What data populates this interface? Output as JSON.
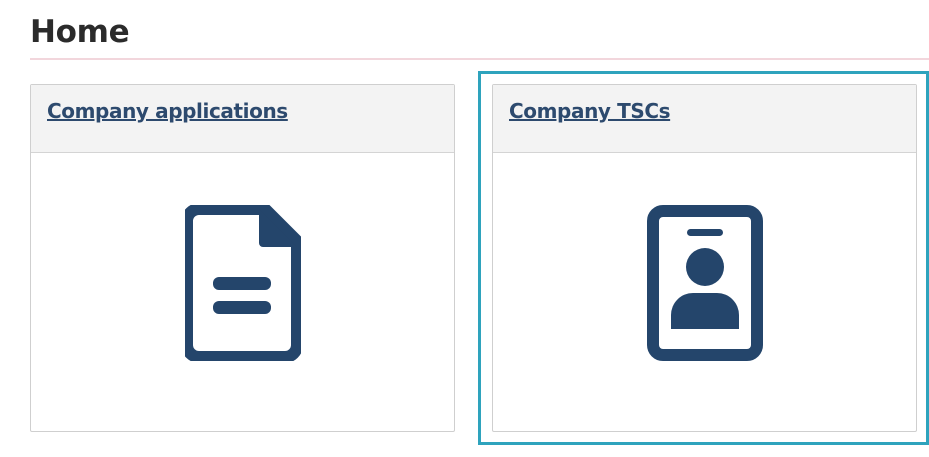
{
  "page": {
    "title": "Home"
  },
  "cards": [
    {
      "link_label": "Company applications",
      "icon": "document-icon"
    },
    {
      "link_label": "Company TSCs",
      "icon": "id-badge-icon"
    }
  ],
  "colors": {
    "icon": "#24456b",
    "link": "#2d4a6e",
    "focus": "#2ea3bd",
    "title_rule": "#f2d6dc"
  }
}
